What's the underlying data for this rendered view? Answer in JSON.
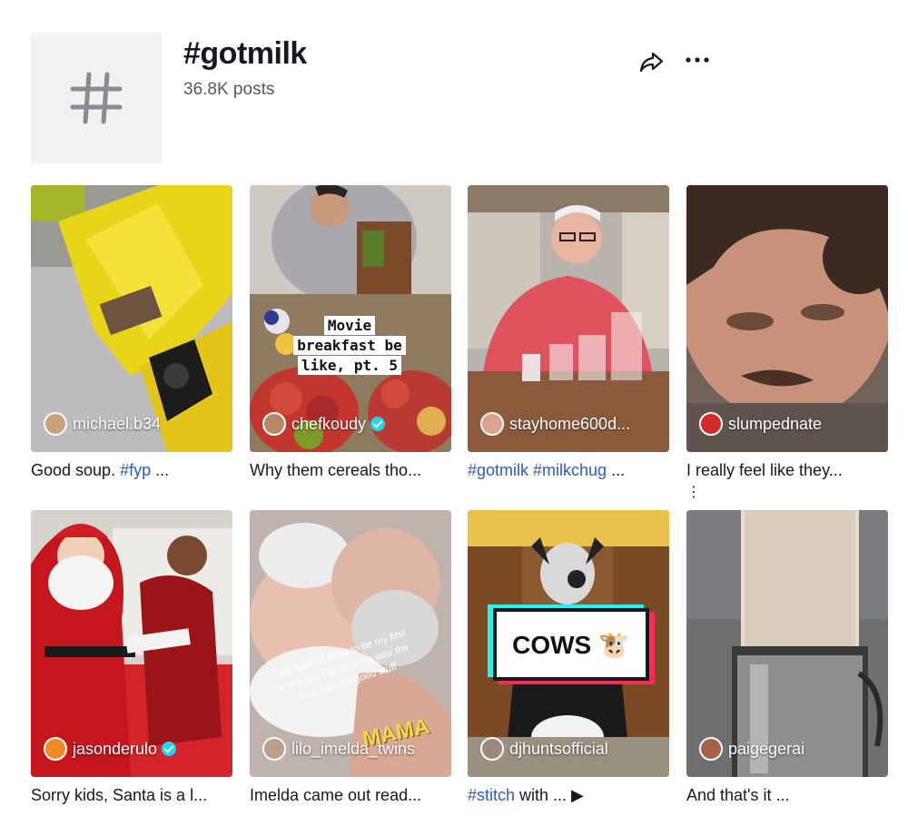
{
  "header": {
    "title": "#gotmilk",
    "post_count": "36.8K posts"
  },
  "videos": [
    {
      "username": "michael.b34",
      "verified": false,
      "caption_parts": [
        "Good soup. ",
        "#fyp",
        " ..."
      ]
    },
    {
      "username": "chefkoudy",
      "verified": true,
      "caption_parts": [
        "Why them cereals tho..."
      ],
      "overlay": [
        "Movie",
        "breakfast be",
        "like, pt. 5"
      ]
    },
    {
      "username": "stayhome600d...",
      "verified": false,
      "caption_parts": [
        "",
        "#gotmilk #milkchug",
        " ..."
      ]
    },
    {
      "username": "slumpednate",
      "verified": false,
      "caption_parts": [
        "I really feel like they..."
      ]
    },
    {
      "username": "jasonderulo",
      "verified": true,
      "caption_parts": [
        "Sorry kids, Santa is a l..."
      ]
    },
    {
      "username": "lilo_imelda_twins",
      "verified": false,
      "caption_parts": [
        "Imelda came out read..."
      ],
      "overlay": [
        "Dad wanted dada to be my first word, but I knew mom was the one with the good stuff",
        "MAMA"
      ]
    },
    {
      "username": "djhuntsofficial",
      "verified": false,
      "caption_parts": [
        "",
        "#stitch",
        " with ..."
      ],
      "overlay": [
        "COWS 🐮"
      ]
    },
    {
      "username": "paigegerai",
      "verified": false,
      "caption_parts": [
        "And that's it ..."
      ]
    }
  ],
  "icons": {
    "share": "share-arrow-icon",
    "more": "more-horizontal-icon",
    "hashtag": "hashtag-icon",
    "kebab": "more-vertical-icon",
    "verified": "verified-badge-icon"
  },
  "colors": {
    "hashtag_link": "#2b5db9",
    "verified": "#20d5ec",
    "accent_cyan": "#25f4ee",
    "accent_red": "#fe2c55"
  }
}
